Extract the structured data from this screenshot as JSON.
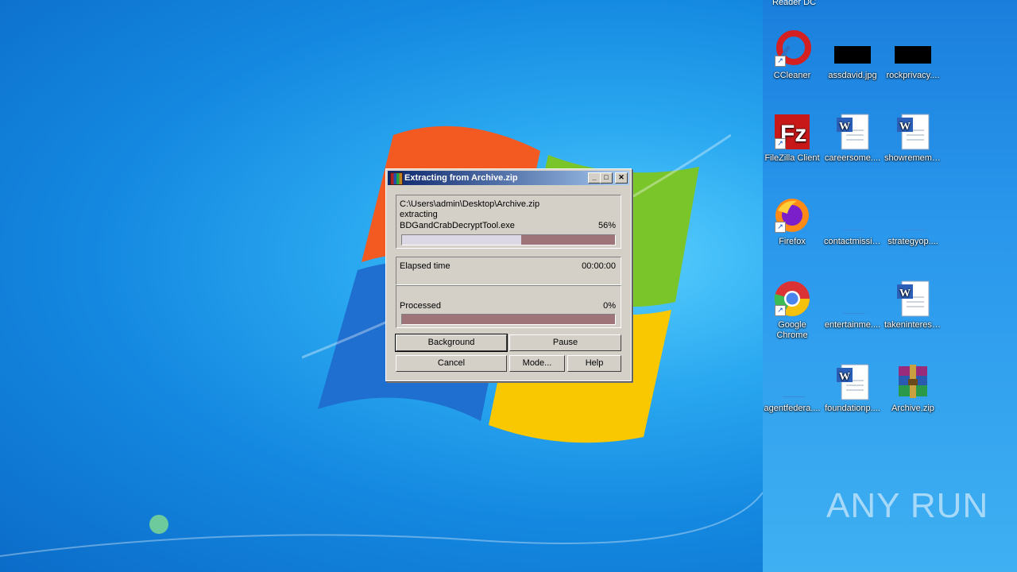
{
  "desktop": {
    "top_label": "Reader DC",
    "icons": [
      {
        "label": "CCleaner",
        "icon": "ccleaner-icon"
      },
      {
        "label": "assdavid.jpg",
        "icon": "image-file-icon"
      },
      {
        "label": "rockprivacy....",
        "icon": "image-file-icon"
      },
      {
        "label": "FileZilla Client",
        "icon": "filezilla-icon"
      },
      {
        "label": "careersome....",
        "icon": "word-document-icon"
      },
      {
        "label": "showremem....",
        "icon": "word-document-icon"
      },
      {
        "label": "Firefox",
        "icon": "firefox-icon"
      },
      {
        "label": "contactmissi....",
        "icon": "blank-file-icon"
      },
      {
        "label": "strategyop....",
        "icon": "blank-file-icon"
      },
      {
        "label": "Google Chrome",
        "icon": "chrome-icon"
      },
      {
        "label": "entertainme....",
        "icon": "blank-file-icon"
      },
      {
        "label": "takeninteres....",
        "icon": "word-document-icon"
      },
      {
        "label": "agentfedera....",
        "icon": "blank-file-icon"
      },
      {
        "label": "foundationp....",
        "icon": "word-document-icon"
      },
      {
        "label": "Archive.zip",
        "icon": "winrar-archive-icon"
      }
    ],
    "watermark": "ANY RUN"
  },
  "dialog": {
    "title": "Extracting from Archive.zip",
    "archive_path": "C:\\Users\\admin\\Desktop\\Archive.zip",
    "action": "extracting",
    "current_file": "BDGandCrabDecryptTool.exe",
    "file_percent_text": "56%",
    "file_progress": 0.56,
    "elapsed_label": "Elapsed time",
    "elapsed_value": "00:00:00",
    "processed_label": "Processed",
    "processed_percent_text": "0%",
    "processed_progress": 0.0,
    "buttons": {
      "background": "Background",
      "pause": "Pause",
      "cancel": "Cancel",
      "mode": "Mode...",
      "help": "Help"
    },
    "title_buttons": {
      "minimize": "_",
      "maximize": "□",
      "close": "✕"
    }
  },
  "colors": {
    "title_start": "#0a246a",
    "title_end": "#a6caf0",
    "dialog_bg": "#d4d0c8",
    "progress_track": "#9e7478",
    "progress_fill": "#dcd8e6"
  }
}
